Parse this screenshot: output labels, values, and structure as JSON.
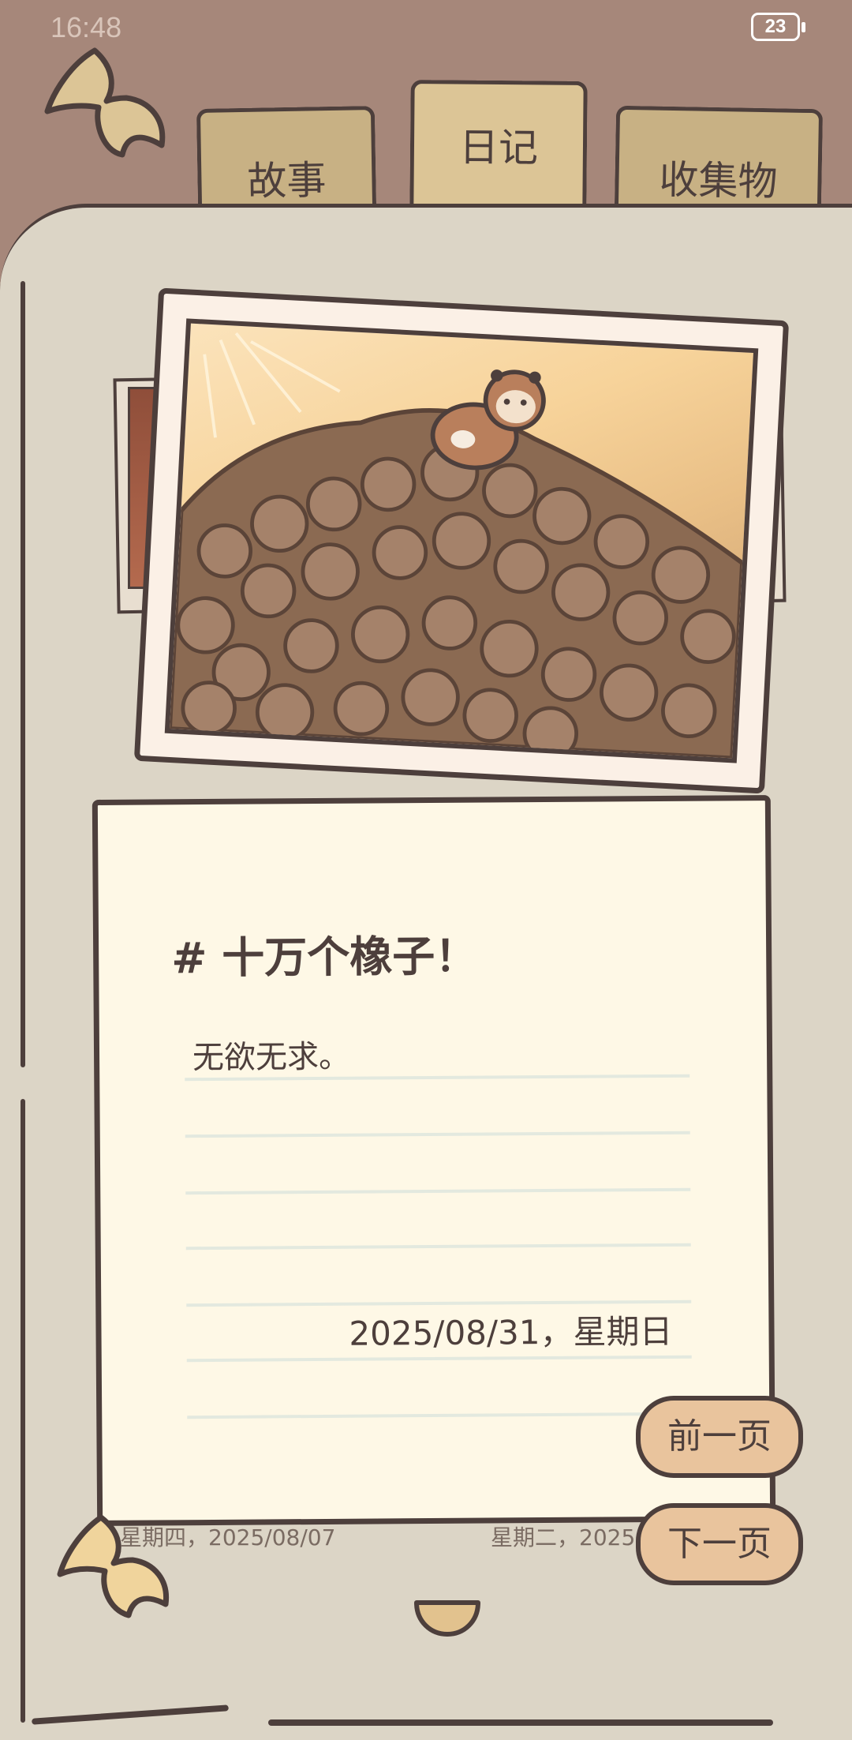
{
  "status_bar": {
    "time": "16:48",
    "battery": "23"
  },
  "tabs": [
    {
      "label": "故事",
      "active": false
    },
    {
      "label": "日记",
      "active": true
    },
    {
      "label": "收集物",
      "active": false
    }
  ],
  "diary": {
    "title": "# 十万个橡子！",
    "body": "无欲无求。",
    "date": "2025/08/31，星期日"
  },
  "buttons": {
    "prev": "前一页",
    "next": "下一页"
  },
  "underlying_entries": {
    "left_date": "星期四，2025/08/07",
    "right_date": "星期二，2025"
  },
  "colors": {
    "header_bg": "#a6877a",
    "page_bg": "#dcd5c6",
    "outline": "#4d3f3c",
    "card_bg": "#fef8e6",
    "button_bg": "#e9c49d",
    "tab_bg": "#c8b184"
  },
  "icons": {
    "back": "back-arrow-icon",
    "bottom_back": "curled-arrow-icon",
    "page_handle": "page-tab-icon"
  }
}
